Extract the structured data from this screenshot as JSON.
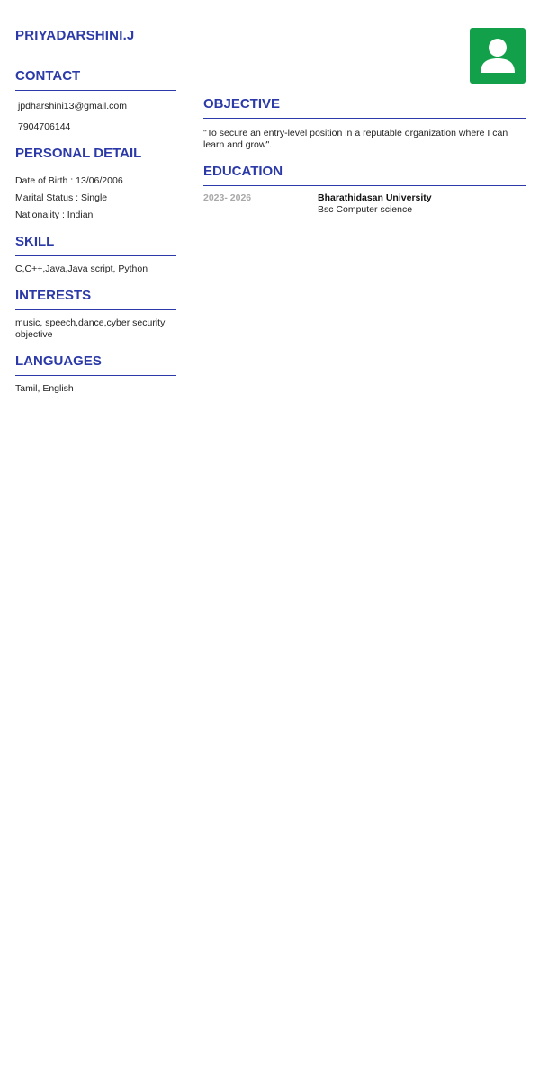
{
  "name": "PRIYADARSHINI.J",
  "photo_icon": "person-avatar-icon",
  "accent_color": "#2b3aa8",
  "avatar_color": "#12a14a",
  "contact": {
    "title": "CONTACT",
    "email": "jpdharshini13@gmail.com",
    "phone": "7904706144"
  },
  "personal": {
    "title": "PERSONAL DETAIL",
    "dob": "Date of Birth : 13/06/2006",
    "marital": "Marital Status : Single",
    "nationality": "Nationality : Indian"
  },
  "skill": {
    "title": "SKILL",
    "text": "C,C++,Java,Java script, Python"
  },
  "interests": {
    "title": "INTERESTS",
    "text": "music, speech,dance,cyber security objective"
  },
  "languages": {
    "title": "LANGUAGES",
    "text": "Tamil, English"
  },
  "objective": {
    "title": "OBJECTIVE",
    "text": "\"To secure an entry-level position in a reputable organization where I can learn and grow\"."
  },
  "education": {
    "title": "EDUCATION",
    "items": [
      {
        "years": "2023- 2026",
        "school": "Bharathidasan University",
        "degree": "Bsc Computer science"
      }
    ]
  }
}
